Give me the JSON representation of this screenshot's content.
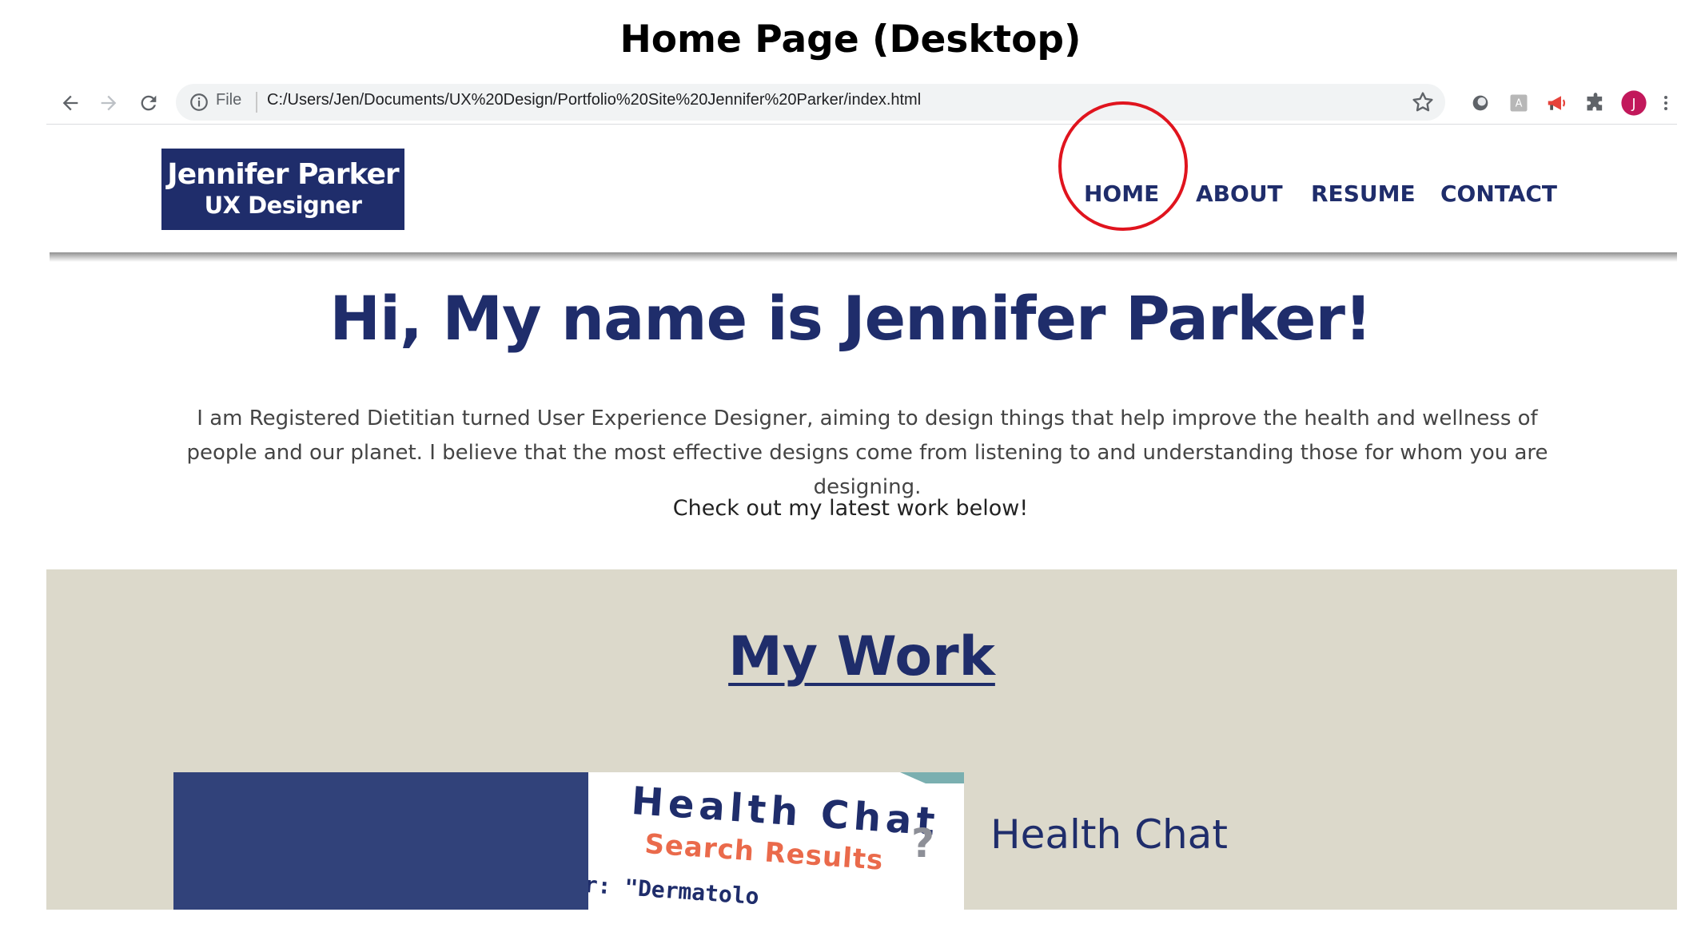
{
  "caption": "Home Page (Desktop)",
  "browser": {
    "back_icon": "back-arrow-icon",
    "forward_icon": "forward-arrow-icon",
    "reload_icon": "reload-icon",
    "scheme_label": "File",
    "url": "C:/Users/Jen/Documents/UX%20Design/Portfolio%20Site%20Jennifer%20Parker/index.html",
    "profile_initial": "J",
    "profile_color": "#c2185b"
  },
  "site": {
    "logo": {
      "name": "Jennifer Parker",
      "role": "UX Designer"
    },
    "nav": [
      "HOME",
      "ABOUT",
      "RESUME",
      "CONTACT"
    ],
    "brand_color": "#1f2d6b",
    "annotation_color": "#e0141e"
  },
  "hero": {
    "title": "Hi, My name is Jennifer Parker!",
    "bio": "I am Registered Dietitian turned User Experience Designer, aiming to design things that help improve the health and wellness of people and our planet. I believe that the most effective designs come from listening to and understanding those for whom you are designing.",
    "cta": "Check out my latest work below!"
  },
  "work": {
    "heading": "My Work",
    "section_bg": "#dcd9cb",
    "projects": [
      {
        "title": "Health Chat",
        "thumbnail": {
          "title": "Health Chat",
          "subtitle": "Search Results",
          "query_fragment": "r: \"Dermatolo",
          "help_glyph": "?"
        }
      }
    ]
  }
}
